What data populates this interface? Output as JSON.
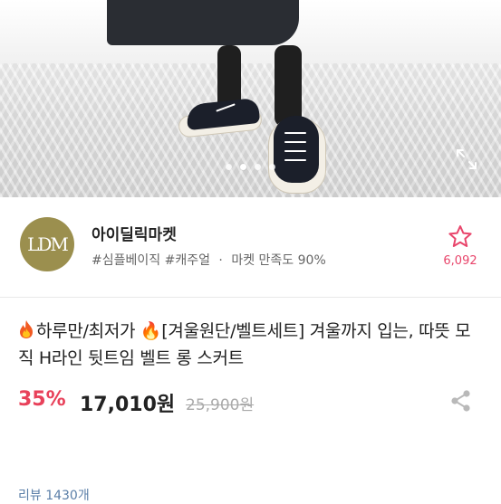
{
  "gallery": {
    "slide_count": 4,
    "active_index": 1
  },
  "store": {
    "logo_text": "LDM",
    "name": "아이딜릭마켓",
    "tag1": "#심플베이직",
    "tag2": "#캐주얼",
    "separator": "·",
    "satisfaction": "마켓 만족도 90%",
    "favorite_count": "6,092",
    "favorite_color": "#e8456b"
  },
  "product": {
    "title": "하루만/최저가 🔥[겨울원단/벨트세트] 겨울까지 입는, 따뜻 모직 H라인 뒷트임 벨트 롱 스커트",
    "discount": "35%",
    "price": "17,010원",
    "original_price": "25,900원",
    "discount_color": "#e8415a"
  },
  "reviews": {
    "label": "리뷰 1430개"
  },
  "icons": {
    "expand": "expand-icon",
    "favorite": "star-outline-icon",
    "share": "share-icon",
    "fire": "fire-icon"
  }
}
